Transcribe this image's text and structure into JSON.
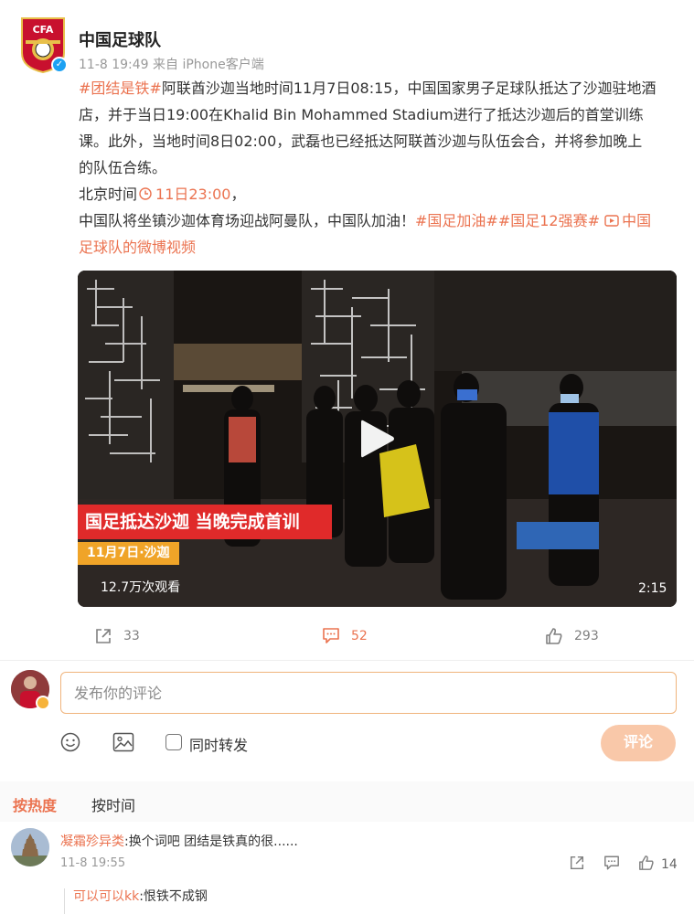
{
  "author": {
    "name": "中国足球队",
    "logo_text": "CFA",
    "meta": "11-8 19:49  来自 iPhone客户端"
  },
  "post": {
    "line1_tag": "#团结是铁#",
    "line1_text": "阿联酋沙迦当地时间11月7日08:15，中国国家男子足球队抵达了沙迦驻地酒",
    "line2": "店，并于当日19:00在Khalid Bin Mohammed Stadium进行了抵达沙迦后的首堂训练",
    "line3": "课。此外，当地时间8日02:00，武磊也已经抵达阿联酋沙迦与队伍会合，并将参加晚上",
    "line4": "的队伍合练。",
    "line5_text": "北京时间",
    "line5_time": "11日23:00",
    "line5_end": "，",
    "line6_text": "中国队将坐镇沙迦体育场迎战阿曼队，中国队加油！",
    "line6_tags": "#国足加油##国足12强赛#",
    "line6_link": "中国",
    "line7_link": "足球队的微博视频"
  },
  "video": {
    "caption_main": "国足抵达沙迦 当晚完成首训",
    "caption_sub": "11月7日·沙迦",
    "views": "12.7万次观看",
    "duration": "2:15"
  },
  "actions": {
    "repost_count": "33",
    "comment_count": "52",
    "like_count": "293"
  },
  "composer": {
    "placeholder": "发布你的评论",
    "repost_label": "同时转发",
    "submit_label": "评论"
  },
  "sort": {
    "hot_label": "按热度",
    "time_label": "按时间"
  },
  "comments": [
    {
      "user": "凝霜殄异类",
      "text": ":换个词吧 团结是铁真的很......",
      "time": "11-8 19:55",
      "likes": "14",
      "reply_user": "可以可以kk",
      "reply_text": ":恨铁不成钢"
    }
  ],
  "colors": {
    "accent": "#eb7350",
    "caption_red": "#e02a2a",
    "caption_yellow": "#f0a428",
    "input_border": "#f0b47c",
    "submit_bg": "#f9c8a9"
  }
}
